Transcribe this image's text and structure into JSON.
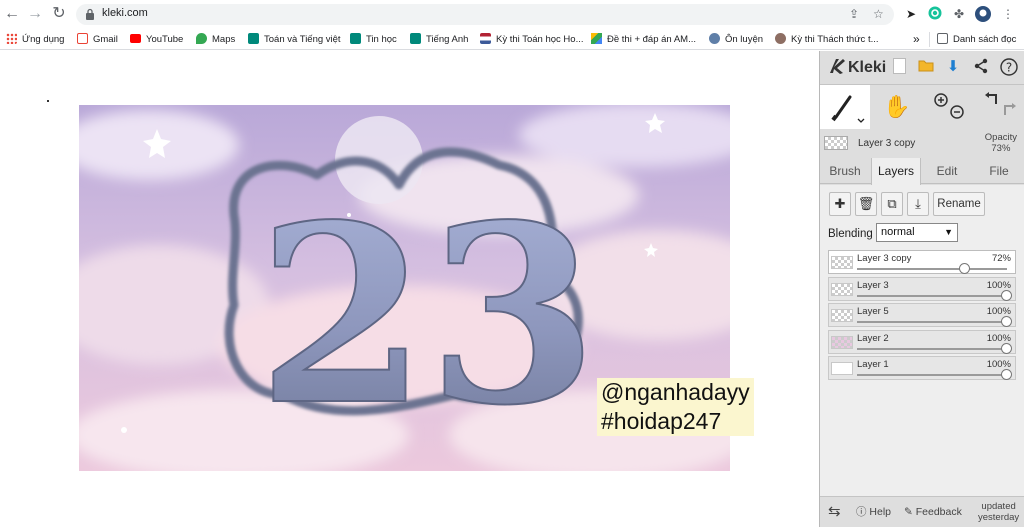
{
  "browser": {
    "url": "kleki.com",
    "bookmarks": [
      {
        "label": "Ứng dụng",
        "icon": "apps-grid-icon",
        "color": "#4285f4"
      },
      {
        "label": "Gmail",
        "icon": "gmail-icon",
        "color": "#ea4335"
      },
      {
        "label": "YouTube",
        "icon": "youtube-icon",
        "color": "#ff0000"
      },
      {
        "label": "Maps",
        "icon": "maps-icon",
        "color": "#34a853"
      },
      {
        "label": "Toán và Tiếng việt",
        "icon": "meet-icon",
        "color": "#00897b"
      },
      {
        "label": "Tin học",
        "icon": "meet-icon",
        "color": "#00897b"
      },
      {
        "label": "Tiếng Anh",
        "icon": "meet-icon",
        "color": "#00897b"
      },
      {
        "label": "Kỳ thi Toán học Ho...",
        "icon": "flag-icon",
        "color": "#3c5a99"
      },
      {
        "label": "Đề thi + đáp án AM...",
        "icon": "drive-icon",
        "color": "#fbbc04"
      },
      {
        "label": "Ôn luyện",
        "icon": "globe-icon",
        "color": "#5f7fa8"
      },
      {
        "label": "Kỳ thi Thách thức t...",
        "icon": "site-icon",
        "color": "#8d6e63"
      }
    ],
    "more_label": "»",
    "reading_list_label": "Danh sách đọc"
  },
  "artwork": {
    "numerals": "23",
    "watermark_line1": "@nganhadayy",
    "watermark_line2": "#hoidap247"
  },
  "kleki": {
    "logo": "Kleki",
    "current_layer_name": "Layer 3 copy",
    "opacity_label": "Opacity",
    "opacity_value": "73%",
    "tabs": [
      "Brush",
      "Layers",
      "Edit",
      "File"
    ],
    "active_tab": "Layers",
    "rename_label": "Rename",
    "blending_label": "Blending",
    "blending_value": "normal",
    "layers": [
      {
        "name": "Layer 3 copy",
        "opacity": "72%",
        "level": 0.72,
        "active": true
      },
      {
        "name": "Layer 3",
        "opacity": "100%",
        "level": 1.0,
        "active": false
      },
      {
        "name": "Layer 5",
        "opacity": "100%",
        "level": 1.0,
        "active": false
      },
      {
        "name": "Layer 2",
        "opacity": "100%",
        "level": 1.0,
        "active": false
      },
      {
        "name": "Layer 1",
        "opacity": "100%",
        "level": 1.0,
        "active": false
      }
    ],
    "footer": {
      "help_label": "Help",
      "feedback_label": "Feedback",
      "updated_line1": "updated",
      "updated_line2": "yesterday"
    }
  }
}
